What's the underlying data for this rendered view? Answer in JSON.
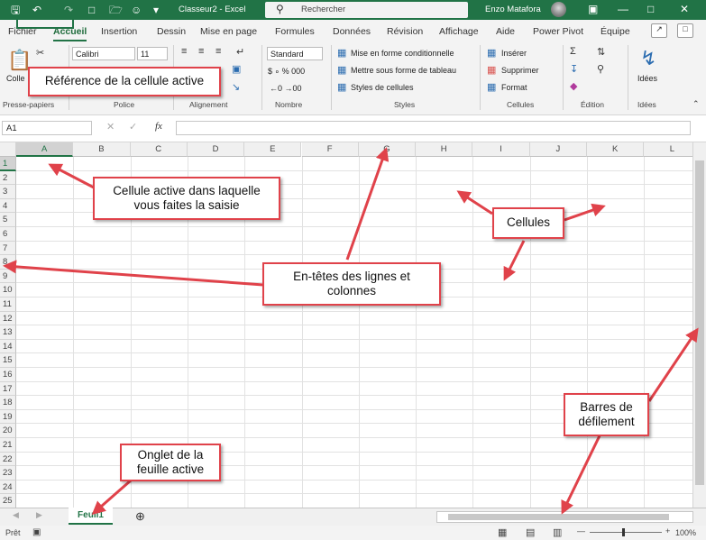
{
  "titlebar": {
    "title": "Classeur2  -  Excel",
    "search_placeholder": "Rechercher",
    "user": "Enzo Matafora"
  },
  "ribbon_tabs": [
    "Fichier",
    "Accueil",
    "Insertion",
    "Dessin",
    "Mise en page",
    "Formules",
    "Données",
    "Révision",
    "Affichage",
    "Aide",
    "Power Pivot",
    "Équipe"
  ],
  "ribbon": {
    "clipboard": {
      "paste_label": "Colle",
      "group_label": "Presse-papiers"
    },
    "font": {
      "name": "Calibri",
      "size": "11",
      "group_label": "Police"
    },
    "alignment": {
      "group_label": "Alignement"
    },
    "number": {
      "format": "Standard",
      "group_label": "Nombre"
    },
    "styles": {
      "conditional": "Mise en forme conditionnelle",
      "table": "Mettre sous forme de tableau",
      "cell_styles": "Styles de cellules",
      "group_label": "Styles"
    },
    "cells": {
      "insert": "Insérer",
      "delete": "Supprimer",
      "format": "Format",
      "group_label": "Cellules"
    },
    "editing": {
      "group_label": "Édition"
    },
    "ideas": {
      "label": "Idées",
      "group_label": "Idées"
    }
  },
  "formula_bar": {
    "name_box": "A1",
    "fx": "fx",
    "value": ""
  },
  "grid": {
    "columns": [
      "A",
      "B",
      "C",
      "D",
      "E",
      "F",
      "G",
      "H",
      "I",
      "J",
      "K",
      "L"
    ],
    "rows": [
      "1",
      "2",
      "3",
      "4",
      "5",
      "6",
      "7",
      "8",
      "9",
      "10",
      "11",
      "12",
      "13",
      "14",
      "15",
      "16",
      "17",
      "18",
      "19",
      "20",
      "21",
      "22",
      "23",
      "24",
      "25"
    ],
    "active_cell": "A1"
  },
  "sheets": {
    "active": "Feuil1"
  },
  "status": {
    "ready": "Prêt",
    "zoom": "100%"
  },
  "callouts": {
    "active_ref": "Référence de la cellule active",
    "active_cell": "Cellule active dans laquelle vous faites la saisie",
    "cells": "Cellules",
    "headers": "En-têtes des lignes et colonnes",
    "scrollbars": "Barres de défilement",
    "sheet_tab": "Onglet de la feuille active"
  },
  "colors": {
    "excel_green": "#217346",
    "callout_red": "#e0424a"
  }
}
